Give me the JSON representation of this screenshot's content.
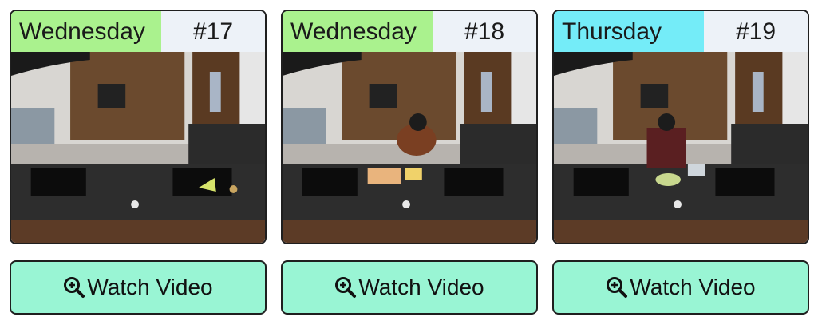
{
  "cards": [
    {
      "day": "Wednesday",
      "number": "#17",
      "day_color": "#aaf28e",
      "button_label": "Watch Video"
    },
    {
      "day": "Wednesday",
      "number": "#18",
      "day_color": "#aaf28e",
      "button_label": "Watch Video"
    },
    {
      "day": "Thursday",
      "number": "#19",
      "day_color": "#74ecf8",
      "button_label": "Watch Video"
    }
  ],
  "icons": {
    "button_icon": "zoom-in-icon"
  },
  "colors": {
    "button_bg": "#99f5d4",
    "card_border": "#1f1f1f"
  }
}
